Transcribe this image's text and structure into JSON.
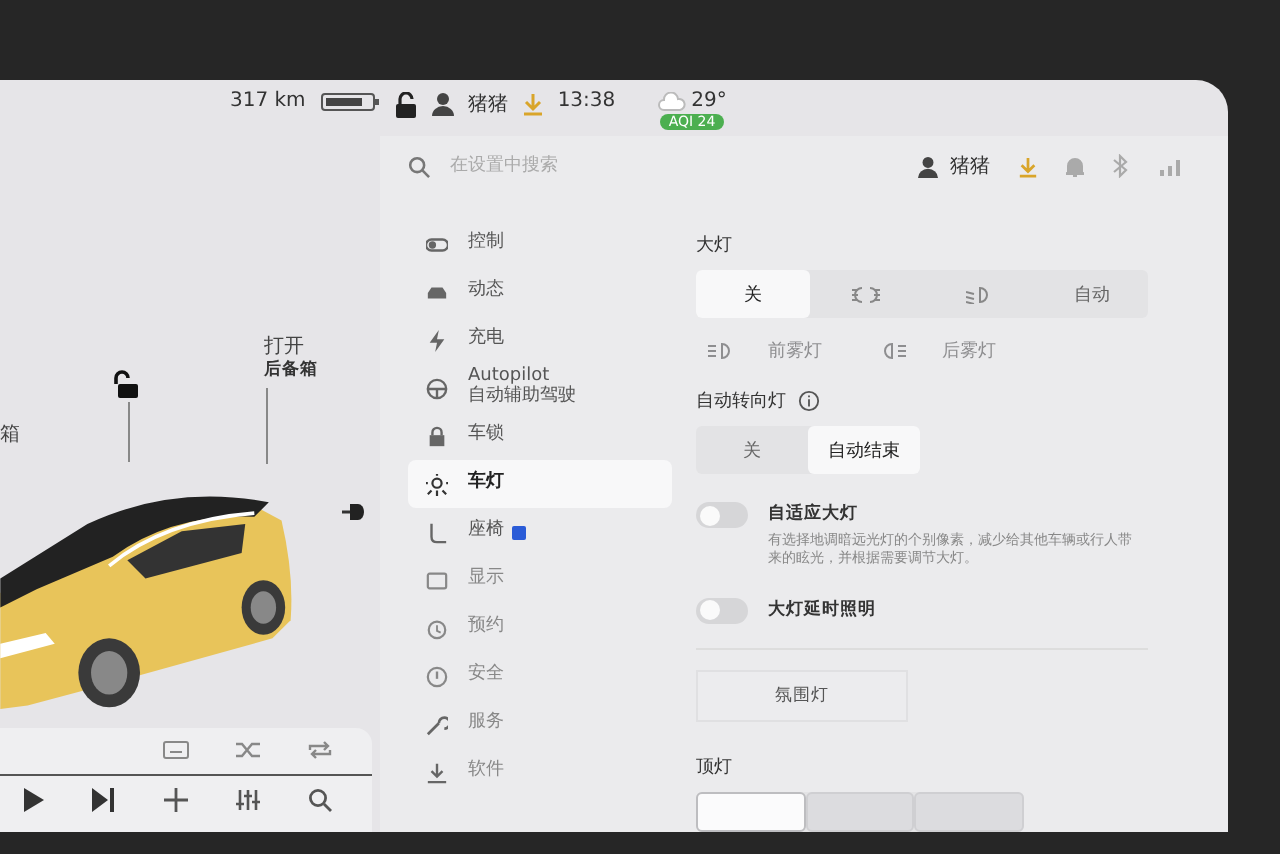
{
  "status_bar": {
    "range": "317 km",
    "driver": "猪猪",
    "time": "13:38",
    "temperature": "29°",
    "aqi": "AQI 24"
  },
  "car_panel": {
    "front_trunk_label": "箱",
    "trunk_action": "打开",
    "trunk_label": "后备箱"
  },
  "settings_header": {
    "search": {
      "placeholder": "在设置中搜索"
    },
    "profile": "猪猪"
  },
  "sidebar": {
    "items": [
      {
        "label": "控制",
        "selected": false,
        "new_badge": false
      },
      {
        "label": "动态",
        "selected": false,
        "new_badge": false
      },
      {
        "label": "充电",
        "selected": false,
        "new_badge": false
      },
      {
        "label": "Autopilot",
        "sublabel": "自动辅助驾驶",
        "selected": false,
        "new_badge": false
      },
      {
        "label": "车锁",
        "selected": false,
        "new_badge": false
      },
      {
        "label": "车灯",
        "selected": true,
        "new_badge": false
      },
      {
        "label": "座椅",
        "selected": false,
        "new_badge": true
      },
      {
        "label": "显示",
        "selected": false,
        "new_badge": false
      },
      {
        "label": "预约",
        "selected": false,
        "new_badge": false
      },
      {
        "label": "安全",
        "selected": false,
        "new_badge": false
      },
      {
        "label": "服务",
        "selected": false,
        "new_badge": false
      },
      {
        "label": "软件",
        "selected": false,
        "new_badge": false
      }
    ]
  },
  "headlights": {
    "title": "大灯",
    "options": [
      {
        "kind": "text",
        "label": "关",
        "selected": true
      },
      {
        "kind": "icon",
        "selected": false
      },
      {
        "kind": "icon",
        "selected": false
      },
      {
        "kind": "text",
        "label": "自动",
        "selected": false
      }
    ]
  },
  "fog_lights": {
    "disabled": true,
    "items": [
      {
        "label": "前雾灯"
      },
      {
        "label": "后雾灯"
      }
    ]
  },
  "turn_signals": {
    "title": "自动转向灯",
    "options": [
      {
        "label": "关",
        "selected": false
      },
      {
        "label": "自动结束",
        "selected": true
      }
    ]
  },
  "toggles": [
    {
      "label": "自适应大灯",
      "description": "有选择地调暗远光灯的个别像素，减少给其他车辆或行人带来的眩光，并根据需要调节大灯。",
      "on": false
    },
    {
      "label": "大灯延时照明",
      "on": false
    }
  ],
  "ambient_button": "氛围灯",
  "dome_lights": {
    "title": "顶灯",
    "options": [
      {
        "selected": true
      },
      {
        "selected": false
      },
      {
        "selected": false
      }
    ]
  }
}
